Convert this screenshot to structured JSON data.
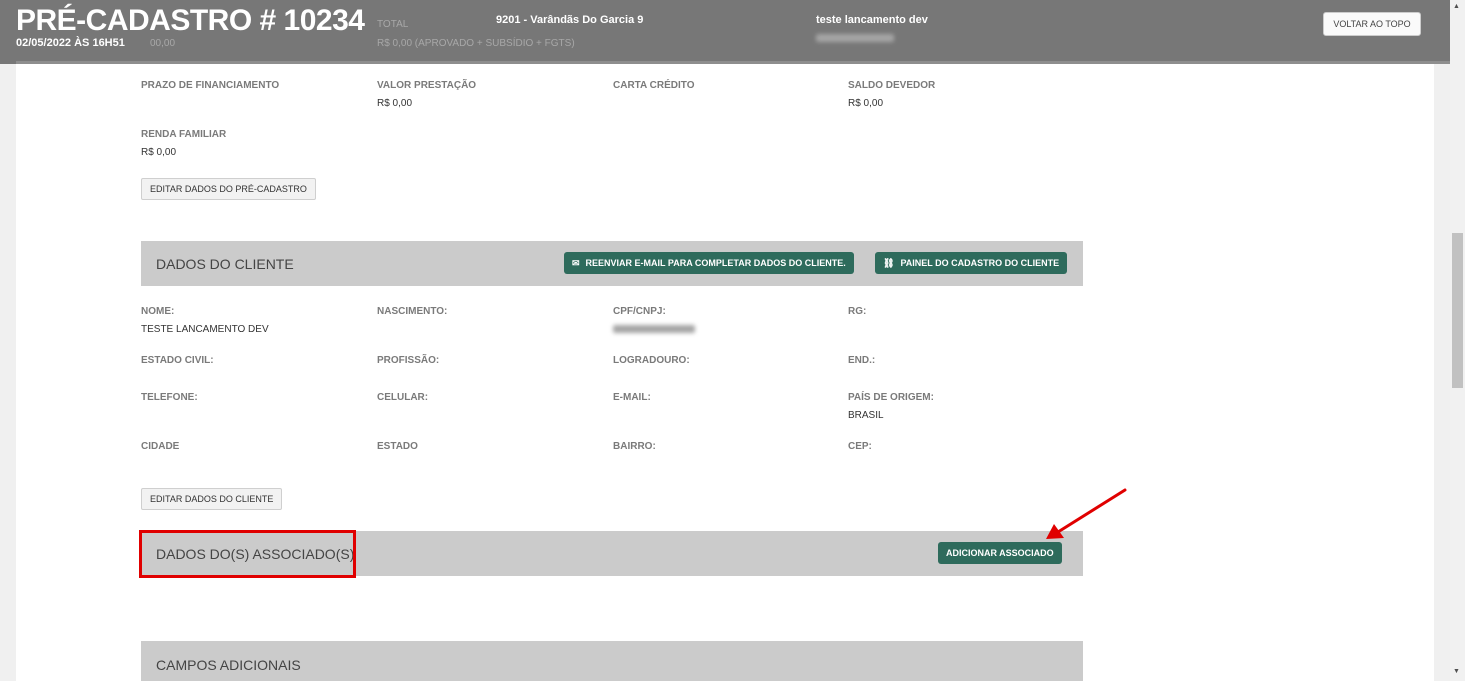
{
  "header": {
    "title": "PRÉ-CADASTRO # 10234",
    "date": "02/05/2022 ÀS 16H51",
    "faded_value": "00,00",
    "faded_total_label": "TOTAL",
    "faded_total_value": "R$ 0,00 (APROVADO + SUBSÍDIO + FGTS)",
    "project": "9201 - Varândãs Do Garcia 9",
    "client_name": "teste lancamento dev",
    "back_to_top": "VOLTAR AO TOPO"
  },
  "financing": {
    "prazo_label": "PRAZO DE FINANCIAMENTO",
    "prestacao_label": "VALOR PRESTAÇÃO",
    "prestacao_value": "R$ 0,00",
    "carta_label": "CARTA CRÉDITO",
    "saldo_label": "SALDO DEVEDOR",
    "saldo_value": "R$ 0,00",
    "renda_label": "RENDA FAMILIAR",
    "renda_value": "R$ 0,00",
    "edit_button": "EDITAR DADOS DO PRÉ-CADASTRO"
  },
  "client": {
    "section_title": "DADOS DO CLIENTE",
    "resend_email_button": "REENVIAR E-MAIL PARA COMPLETAR DADOS DO CLIENTE.",
    "panel_button": "PAINEL DO CADASTRO DO CLIENTE",
    "nome_label": "NOME:",
    "nome_value": "TESTE LANCAMENTO DEV",
    "nascimento_label": "NASCIMENTO:",
    "cpf_label": "CPF/CNPJ:",
    "rg_label": "RG:",
    "estado_civil_label": "ESTADO CIVIL:",
    "profissao_label": "PROFISSÃO:",
    "logradouro_label": "LOGRADOURO:",
    "end_label": "END.:",
    "telefone_label": "TELEFONE:",
    "celular_label": "CELULAR:",
    "email_label": "E-MAIL:",
    "pais_label": "PAÍS DE ORIGEM:",
    "pais_value": "BRASIL",
    "cidade_label": "CIDADE",
    "estado_label": "ESTADO",
    "bairro_label": "BAIRRO:",
    "cep_label": "CEP:",
    "edit_button": "EDITAR DADOS DO CLIENTE"
  },
  "associados": {
    "section_title": "DADOS DO(S) ASSOCIADO(S)",
    "add_button": "ADICIONAR ASSOCIADO"
  },
  "campos": {
    "section_title": "CAMPOS ADICIONAIS"
  },
  "colors": {
    "header_bg": "#777777",
    "section_bg": "#cbcbcb",
    "button_green": "#2e6b5c",
    "annotation_red": "#e00000"
  }
}
